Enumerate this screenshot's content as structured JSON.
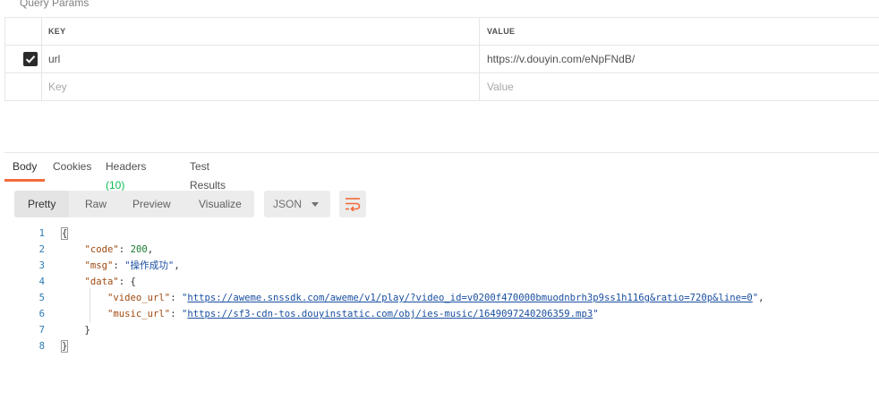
{
  "section_title": "Query Params",
  "params": {
    "headers": {
      "key": "KEY",
      "value": "VALUE"
    },
    "rows": [
      {
        "checked": true,
        "key": "url",
        "value": "https://v.douyin.com/eNpFNdB/"
      }
    ],
    "placeholder": {
      "key": "Key",
      "value": "Value"
    }
  },
  "response_tabs": {
    "body": "Body",
    "cookies": "Cookies",
    "headers": "Headers",
    "headers_count": "(10)",
    "test_results": "Test Results"
  },
  "view_modes": {
    "pretty": "Pretty",
    "raw": "Raw",
    "preview": "Preview",
    "visualize": "Visualize"
  },
  "format": "JSON",
  "code": {
    "line_numbers": [
      "1",
      "2",
      "3",
      "4",
      "5",
      "6",
      "7",
      "8"
    ],
    "open_brace": "{",
    "close_brace": "}",
    "code_key": "\"code\"",
    "code_value": "200",
    "msg_key": "\"msg\"",
    "msg_value": "\"操作成功\"",
    "data_key": "\"data\"",
    "video_key": "\"video_url\"",
    "video_value": "https://aweme.snssdk.com/aweme/v1/play/?video_id=v0200f470000bmuodnbrh3p9ss1h116g&ratio=720p&line=0",
    "music_key": "\"music_url\"",
    "music_value": "https://sf3-cdn-tos.douyinstatic.com/obj/ies-music/1649097240206359.mp3"
  },
  "colors": {
    "accent": "#f26b3a",
    "count": "#0cbb52",
    "line_numbers": "#2b7bb5"
  }
}
